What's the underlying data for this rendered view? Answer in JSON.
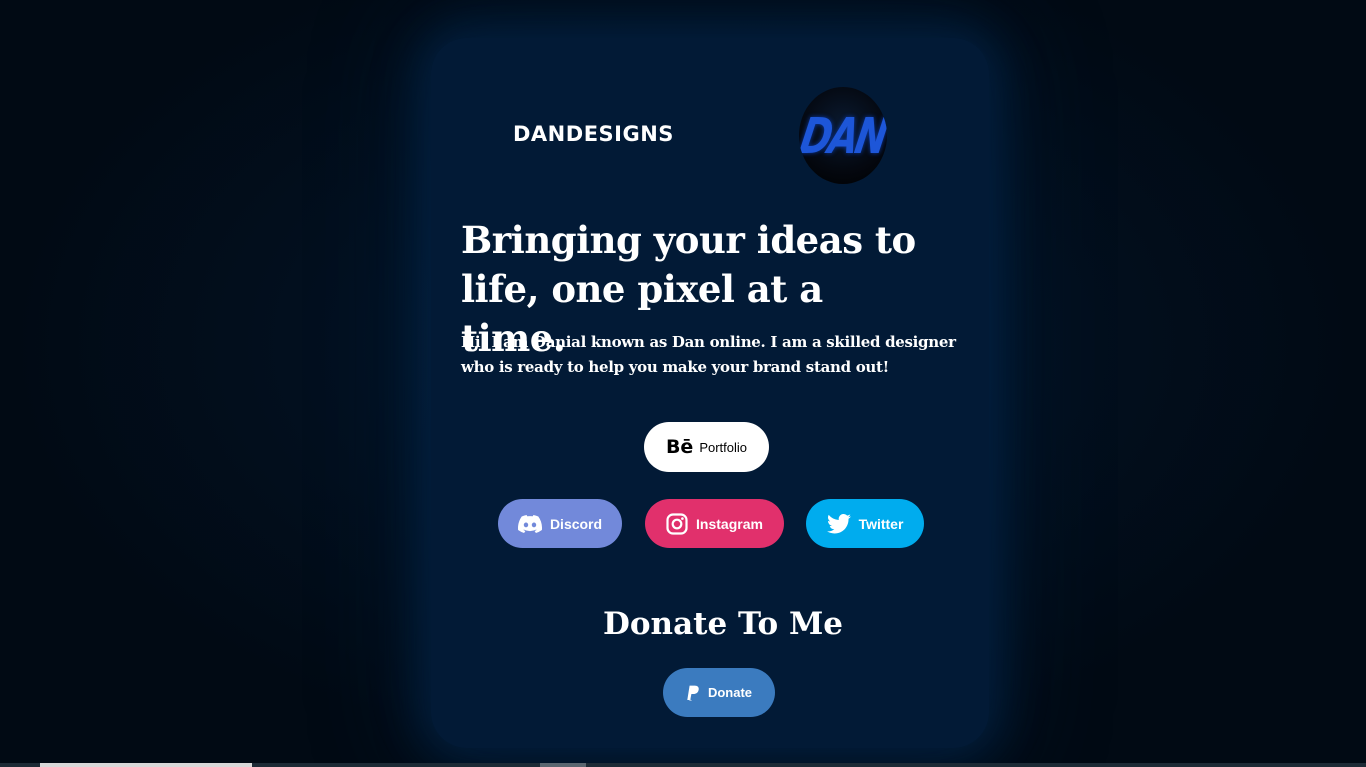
{
  "brand": {
    "name": "DANDESIGNS",
    "logo_text": "DAN"
  },
  "hero": {
    "headline": "Bringing your ideas to life, one pixel at a time.",
    "intro": "Hi! I am Danial known as Dan online. I am a skilled designer who is ready to help you make your brand stand out!"
  },
  "links": {
    "portfolio": {
      "icon": "behance-icon",
      "label": "Portfolio",
      "glyph": "Bē"
    },
    "discord": {
      "icon": "discord-icon",
      "label": "Discord",
      "color": "#7289da"
    },
    "instagram": {
      "icon": "instagram-icon",
      "label": "Instagram",
      "color": "#e1306c"
    },
    "twitter": {
      "icon": "twitter-icon",
      "label": "Twitter",
      "color": "#00acee"
    }
  },
  "donate": {
    "title": "Donate To Me",
    "button": {
      "icon": "paypal-icon",
      "label": "Donate",
      "color": "#3b7bbf"
    }
  },
  "theme": {
    "background": "#010a14",
    "card": "#021a36"
  }
}
